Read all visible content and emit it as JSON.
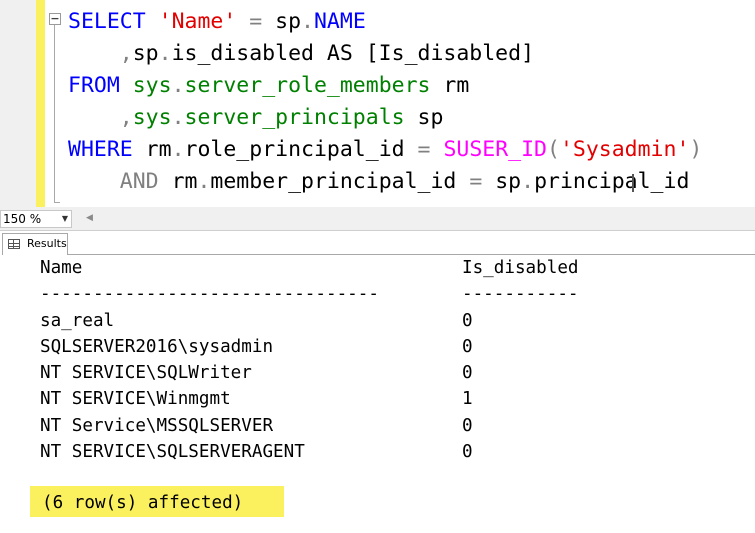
{
  "editor": {
    "lines": [
      [
        "SELECT",
        " ",
        "'Name'",
        " = ",
        "sp",
        ".",
        "NAME"
      ],
      [
        "    ",
        ",",
        "sp",
        ".",
        "is_disabled AS [Is_disabled]"
      ],
      [
        "FROM",
        " ",
        "sys",
        ".",
        "server_role_members",
        " rm"
      ],
      [
        "    ",
        ",",
        "sys",
        ".",
        "server_principals",
        " sp"
      ],
      [
        "WHERE",
        " rm",
        ".",
        "role_principal_id ",
        "=",
        " ",
        "SUSER_ID",
        "(",
        "'Sysadmin'",
        ")"
      ],
      [
        "    ",
        "AND",
        " rm",
        ".",
        "member_principal_id ",
        "=",
        " sp",
        ".",
        "principal_id"
      ]
    ]
  },
  "statusbar": {
    "zoom": "150 %",
    "zoom_arrow": "▼",
    "scroll_left_arrow": "◀"
  },
  "results": {
    "tab_label": "Results",
    "header_name": "Name",
    "header_disabled": "Is_disabled",
    "divider_name": "--------------------------------",
    "divider_disabled": "-----------",
    "rows": [
      {
        "name": "sa_real",
        "is_disabled": "0"
      },
      {
        "name": "SQLSERVER2016\\sysadmin",
        "is_disabled": "0"
      },
      {
        "name": "NT SERVICE\\SQLWriter",
        "is_disabled": "0"
      },
      {
        "name": "NT SERVICE\\Winmgmt",
        "is_disabled": "1"
      },
      {
        "name": "NT Service\\MSSQLSERVER",
        "is_disabled": "0"
      },
      {
        "name": "NT SERVICE\\SQLSERVERAGENT",
        "is_disabled": "0"
      }
    ],
    "affected": "(6 row(s) affected)"
  },
  "colors": {
    "keyword": "#0000ff",
    "string": "#e30000",
    "system_object": "#008000",
    "function": "#ff00ff",
    "operator": "#808080",
    "highlight": "#fbf05e"
  }
}
